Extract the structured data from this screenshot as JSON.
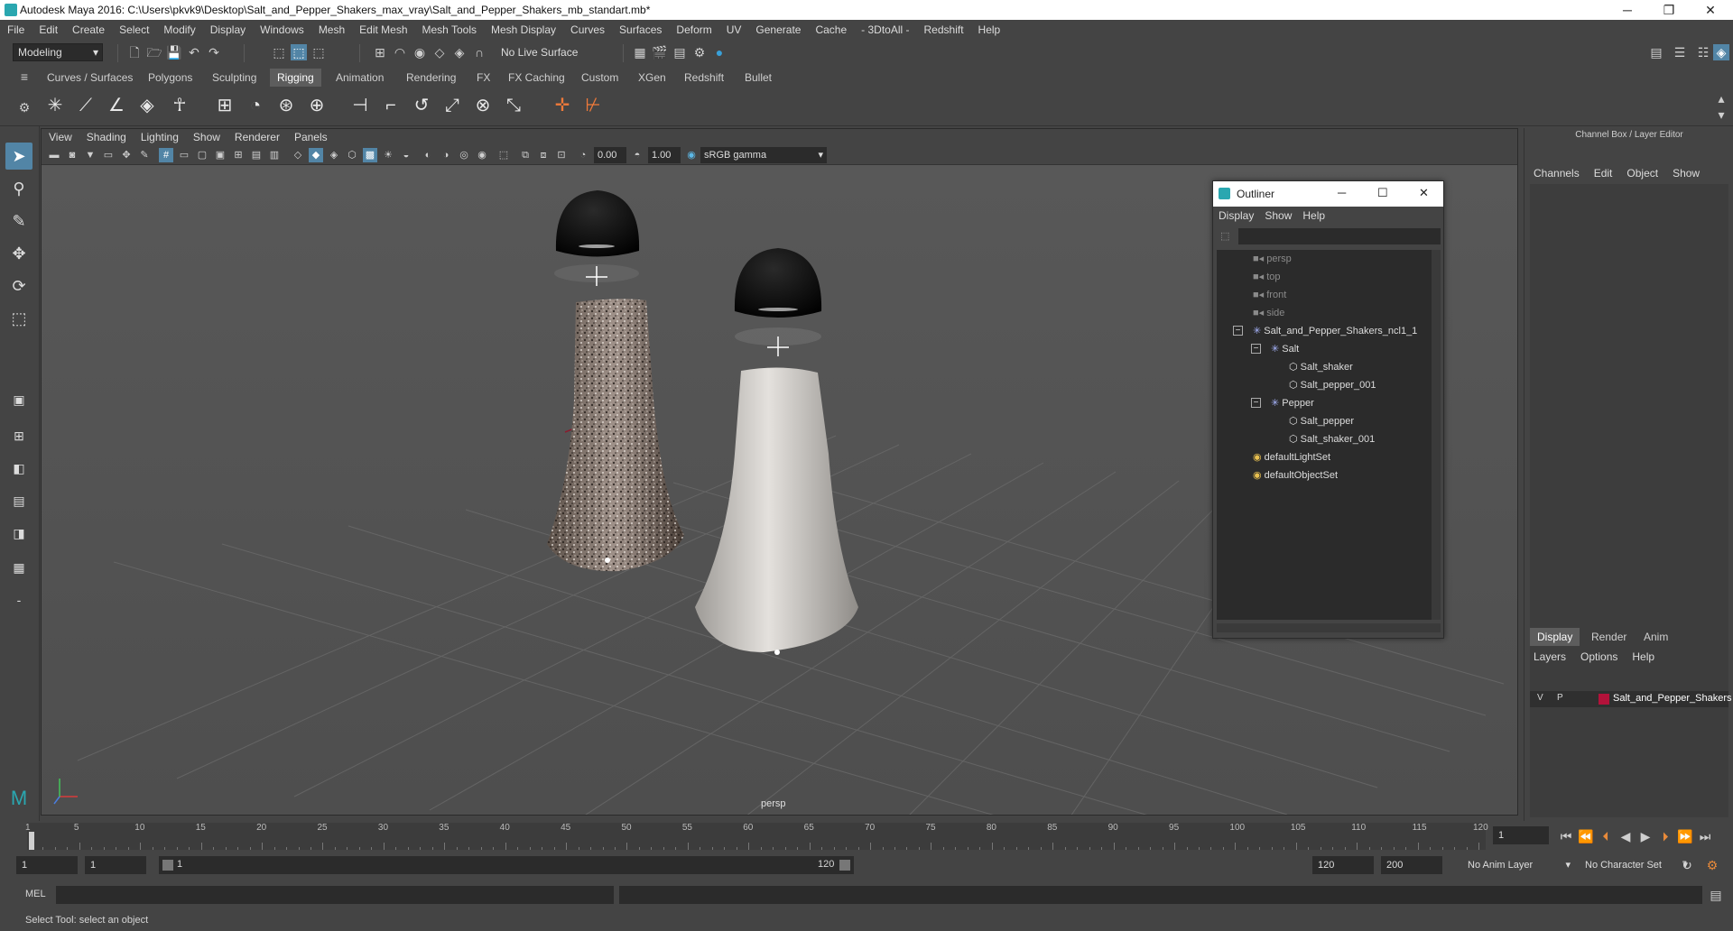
{
  "window": {
    "title": "Autodesk Maya 2016: C:\\Users\\pkvk9\\Desktop\\Salt_and_Pepper_Shakers_max_vray\\Salt_and_Pepper_Shakers_mb_standart.mb*",
    "minimize": "─",
    "maximize": "❐",
    "close": "✕"
  },
  "menubar": [
    "File",
    "Edit",
    "Create",
    "Select",
    "Modify",
    "Display",
    "Windows",
    "Mesh",
    "Edit Mesh",
    "Mesh Tools",
    "Mesh Display",
    "Curves",
    "Surfaces",
    "Deform",
    "UV",
    "Generate",
    "Cache",
    "- 3DtoAll -",
    "Redshift",
    "Help"
  ],
  "statusline": {
    "mode": "Modeling",
    "live_surface": "No Live Surface"
  },
  "shelf": {
    "tabs": [
      "Curves / Surfaces",
      "Polygons",
      "Sculpting",
      "Rigging",
      "Animation",
      "Rendering",
      "FX",
      "FX Caching",
      "Custom",
      "XGen",
      "Redshift",
      "Bullet"
    ],
    "active_tab": "Rigging"
  },
  "viewport": {
    "menu": [
      "View",
      "Shading",
      "Lighting",
      "Show",
      "Renderer",
      "Panels"
    ],
    "exposure": "0.00",
    "gamma": "1.00",
    "color_space": "sRGB gamma",
    "camera": "persp"
  },
  "outliner": {
    "title": "Outliner",
    "menu": [
      "Display",
      "Show",
      "Help"
    ],
    "items": [
      {
        "label": "persp",
        "indent": 0,
        "icon": "camera-icon",
        "dim": true
      },
      {
        "label": "top",
        "indent": 0,
        "icon": "camera-icon",
        "dim": true
      },
      {
        "label": "front",
        "indent": 0,
        "icon": "camera-icon",
        "dim": true
      },
      {
        "label": "side",
        "indent": 0,
        "icon": "camera-icon",
        "dim": true
      },
      {
        "label": "Salt_and_Pepper_Shakers_ncl1_1",
        "indent": 0,
        "icon": "group-icon",
        "expander": "−"
      },
      {
        "label": "Salt",
        "indent": 1,
        "icon": "group-icon",
        "expander": "−"
      },
      {
        "label": "Salt_shaker",
        "indent": 2,
        "icon": "mesh-icon"
      },
      {
        "label": "Salt_pepper_001",
        "indent": 2,
        "icon": "mesh-icon"
      },
      {
        "label": "Pepper",
        "indent": 1,
        "icon": "group-icon",
        "expander": "−"
      },
      {
        "label": "Salt_pepper",
        "indent": 2,
        "icon": "mesh-icon"
      },
      {
        "label": "Salt_shaker_001",
        "indent": 2,
        "icon": "mesh-icon"
      },
      {
        "label": "defaultLightSet",
        "indent": 0,
        "icon": "set-icon"
      },
      {
        "label": "defaultObjectSet",
        "indent": 0,
        "icon": "set-icon"
      }
    ]
  },
  "channelbox": {
    "title": "Channel Box / Layer Editor",
    "menu": [
      "Channels",
      "Edit",
      "Object",
      "Show"
    ],
    "layer_tabs": [
      "Display",
      "Render",
      "Anim"
    ],
    "layer_menu": [
      "Layers",
      "Options",
      "Help"
    ],
    "layer": {
      "v": "V",
      "p": "P",
      "name": "Salt_and_Pepper_Shakers",
      "color": "#b3123a"
    }
  },
  "timeslider": {
    "ticks": [
      "5",
      "10",
      "15",
      "20",
      "25",
      "30",
      "35",
      "40",
      "45",
      "50",
      "55",
      "60",
      "65",
      "70",
      "75",
      "80",
      "85",
      "90",
      "95",
      "100",
      "105",
      "110",
      "115",
      "120"
    ],
    "first_tick": "1",
    "current_frame": "1"
  },
  "rangeslider": {
    "start": "1",
    "playback_start": "1",
    "range_start_label": "1",
    "range_end_label": "120",
    "playback_end": "120",
    "end": "200",
    "anim_layer": "No Anim Layer",
    "character_set": "No Character Set"
  },
  "cmdline": {
    "label": "MEL"
  },
  "helpline": {
    "text": "Select Tool: select an object"
  },
  "colors": {
    "accent": "#5285a6",
    "salt_body": "#d4d1cc",
    "cap": "#050505"
  }
}
